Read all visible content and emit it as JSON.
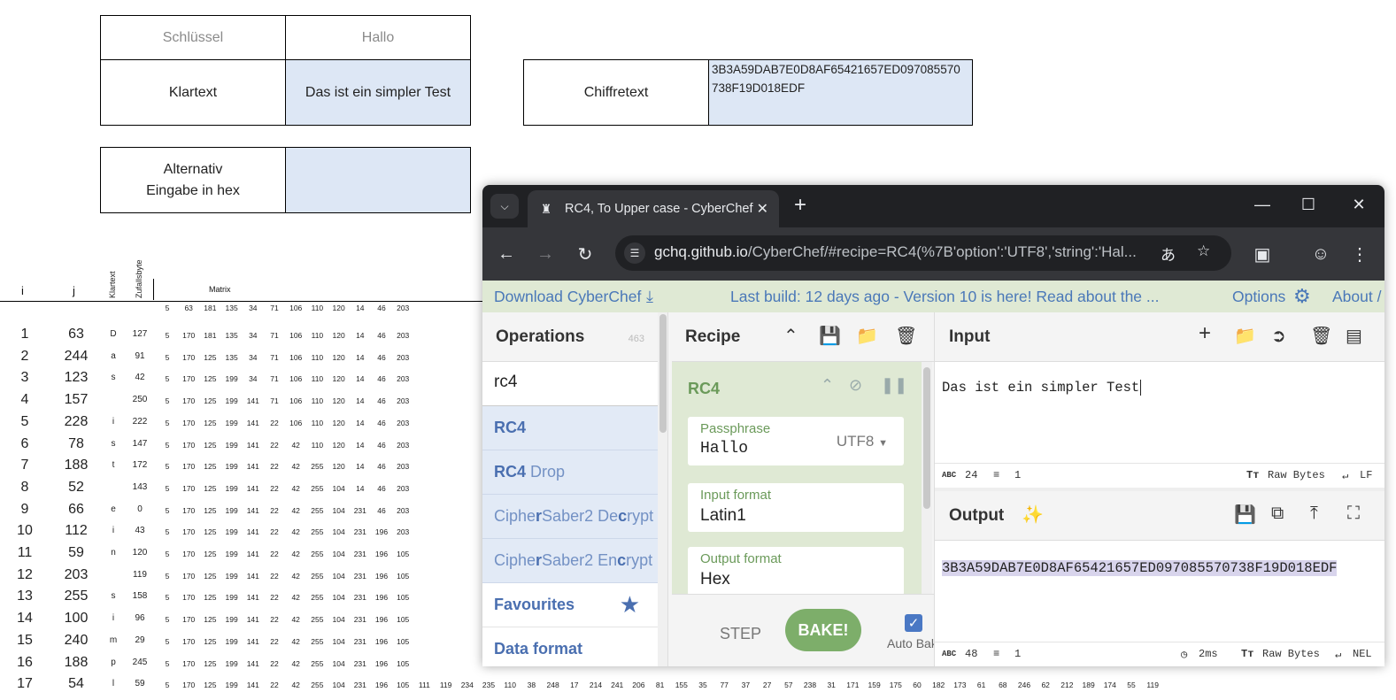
{
  "sheet": {
    "key_label": "Schlüssel",
    "key_value": "Hallo",
    "plain_label": "Klartext",
    "plain_value": "Das ist ein simpler Test",
    "cipher_label": "Chiffretext",
    "cipher_value_line1": "3B3A59DAB7E0D8AF65421657ED097085570",
    "cipher_value_line2": "738F19D018EDF",
    "alt_label_line1": "Alternativ",
    "alt_label_line2": "Eingabe in hex",
    "alt_value": "",
    "col_i": "i",
    "col_j": "j",
    "col_klartext": "Klartext",
    "col_zufallsbyte": "Zufallsbyte",
    "col_matrix": "Matrix",
    "matrix_header": [
      "5",
      "63",
      "181",
      "135",
      "34",
      "71",
      "106",
      "110",
      "120",
      "14",
      "46",
      "203"
    ],
    "rows": [
      {
        "i": "1",
        "j": "63",
        "k": "D",
        "z": "127",
        "m": [
          "5",
          "170",
          "181",
          "135",
          "34",
          "71",
          "106",
          "110",
          "120",
          "14",
          "46",
          "203"
        ]
      },
      {
        "i": "2",
        "j": "244",
        "k": "a",
        "z": "91",
        "m": [
          "5",
          "170",
          "125",
          "135",
          "34",
          "71",
          "106",
          "110",
          "120",
          "14",
          "46",
          "203"
        ]
      },
      {
        "i": "3",
        "j": "123",
        "k": "s",
        "z": "42",
        "m": [
          "5",
          "170",
          "125",
          "199",
          "34",
          "71",
          "106",
          "110",
          "120",
          "14",
          "46",
          "203"
        ]
      },
      {
        "i": "4",
        "j": "157",
        "k": "",
        "z": "250",
        "m": [
          "5",
          "170",
          "125",
          "199",
          "141",
          "71",
          "106",
          "110",
          "120",
          "14",
          "46",
          "203"
        ]
      },
      {
        "i": "5",
        "j": "228",
        "k": "i",
        "z": "222",
        "m": [
          "5",
          "170",
          "125",
          "199",
          "141",
          "22",
          "106",
          "110",
          "120",
          "14",
          "46",
          "203"
        ]
      },
      {
        "i": "6",
        "j": "78",
        "k": "s",
        "z": "147",
        "m": [
          "5",
          "170",
          "125",
          "199",
          "141",
          "22",
          "42",
          "110",
          "120",
          "14",
          "46",
          "203"
        ]
      },
      {
        "i": "7",
        "j": "188",
        "k": "t",
        "z": "172",
        "m": [
          "5",
          "170",
          "125",
          "199",
          "141",
          "22",
          "42",
          "255",
          "120",
          "14",
          "46",
          "203"
        ]
      },
      {
        "i": "8",
        "j": "52",
        "k": "",
        "z": "143",
        "m": [
          "5",
          "170",
          "125",
          "199",
          "141",
          "22",
          "42",
          "255",
          "104",
          "14",
          "46",
          "203"
        ]
      },
      {
        "i": "9",
        "j": "66",
        "k": "e",
        "z": "0",
        "m": [
          "5",
          "170",
          "125",
          "199",
          "141",
          "22",
          "42",
          "255",
          "104",
          "231",
          "46",
          "203"
        ]
      },
      {
        "i": "10",
        "j": "112",
        "k": "i",
        "z": "43",
        "m": [
          "5",
          "170",
          "125",
          "199",
          "141",
          "22",
          "42",
          "255",
          "104",
          "231",
          "196",
          "203"
        ]
      },
      {
        "i": "11",
        "j": "59",
        "k": "n",
        "z": "120",
        "m": [
          "5",
          "170",
          "125",
          "199",
          "141",
          "22",
          "42",
          "255",
          "104",
          "231",
          "196",
          "105"
        ]
      },
      {
        "i": "12",
        "j": "203",
        "k": "",
        "z": "119",
        "m": [
          "5",
          "170",
          "125",
          "199",
          "141",
          "22",
          "42",
          "255",
          "104",
          "231",
          "196",
          "105"
        ]
      },
      {
        "i": "13",
        "j": "255",
        "k": "s",
        "z": "158",
        "m": [
          "5",
          "170",
          "125",
          "199",
          "141",
          "22",
          "42",
          "255",
          "104",
          "231",
          "196",
          "105"
        ]
      },
      {
        "i": "14",
        "j": "100",
        "k": "i",
        "z": "96",
        "m": [
          "5",
          "170",
          "125",
          "199",
          "141",
          "22",
          "42",
          "255",
          "104",
          "231",
          "196",
          "105"
        ]
      },
      {
        "i": "15",
        "j": "240",
        "k": "m",
        "z": "29",
        "m": [
          "5",
          "170",
          "125",
          "199",
          "141",
          "22",
          "42",
          "255",
          "104",
          "231",
          "196",
          "105"
        ]
      },
      {
        "i": "16",
        "j": "188",
        "k": "p",
        "z": "245",
        "m": [
          "5",
          "170",
          "125",
          "199",
          "141",
          "22",
          "42",
          "255",
          "104",
          "231",
          "196",
          "105"
        ]
      },
      {
        "i": "17",
        "j": "54",
        "k": "l",
        "z": "59",
        "m": [
          "5",
          "170",
          "125",
          "199",
          "141",
          "22",
          "42",
          "255",
          "104",
          "231",
          "196",
          "105",
          "111",
          "119",
          "234",
          "235",
          "110",
          "38",
          "248",
          "17",
          "214",
          "241",
          "206",
          "81",
          "155",
          "35",
          "77",
          "37",
          "27",
          "57",
          "238",
          "31",
          "171",
          "159",
          "175",
          "60",
          "182",
          "173",
          "61",
          "68",
          "246",
          "62",
          "212",
          "189",
          "174",
          "55",
          "119"
        ]
      }
    ]
  },
  "browser": {
    "tab_title": "RC4, To Upper case - CyberChef",
    "url_host": "gchq.github.io",
    "url_rest": "/CyberChef/#recipe=RC4(%7B'option':'UTF8','string':'Hal...",
    "icons": {
      "tab_dropdown": "chevron-down-icon",
      "favicon": "chef-hat-icon",
      "back": "arrow-left-icon",
      "forward": "arrow-right-icon",
      "reload": "reload-icon",
      "translate": "translate-icon",
      "star": "star-icon",
      "extensions": "puzzle-icon",
      "profile": "account-icon",
      "menu": "kebab-menu-icon"
    }
  },
  "cyberchef": {
    "banner_download": "Download CyberChef",
    "banner_build": "Last build: 12 days ago - Version 10 is here! Read about the ...",
    "banner_options": "Options",
    "banner_about": "About /",
    "ops_title": "Operations",
    "ops_count": "463",
    "ops_search": "rc4",
    "ops_results": [
      {
        "pre": "",
        "bold": "RC4",
        "post": ""
      },
      {
        "pre": "",
        "bold": "RC4",
        "post": " Drop"
      },
      {
        "pre": "Ciphe",
        "bold": "r",
        "post": "Saber2 De",
        "bold2": "c",
        "post2": "rypt"
      },
      {
        "pre": "Ciphe",
        "bold": "r",
        "post": "Saber2 En",
        "bold2": "c",
        "post2": "rypt"
      }
    ],
    "cat_favourites": "Favourites",
    "cat_data_format": "Data format",
    "recipe_title": "Recipe",
    "recipe_op_name": "RC4",
    "passphrase_label": "Passphrase",
    "passphrase_value": "Hallo",
    "passphrase_encoding": "UTF8",
    "input_format_label": "Input format",
    "input_format_value": "Latin1",
    "output_format_label": "Output format",
    "output_format_value": "Hex",
    "step_label": "STEP",
    "bake_label": "BAKE!",
    "auto_bake_label": "Auto Bake",
    "input_title": "Input",
    "input_text": "Das ist ein simpler Test",
    "input_chars": "24",
    "input_lines": "1",
    "input_raw": "Raw Bytes",
    "input_eol": "LF",
    "output_title": "Output",
    "output_text": "3B3A59DAB7E0D8AF65421657ED097085570738F19D018EDF",
    "output_chars": "48",
    "output_lines": "1",
    "output_time": "2ms",
    "output_raw": "Raw Bytes",
    "output_eol": "NEL",
    "colors": {
      "banner_bg": "#dfe9d4",
      "op_bg": "#e2eaf6",
      "bake": "#7dae6a",
      "link": "#4a78b8"
    }
  }
}
